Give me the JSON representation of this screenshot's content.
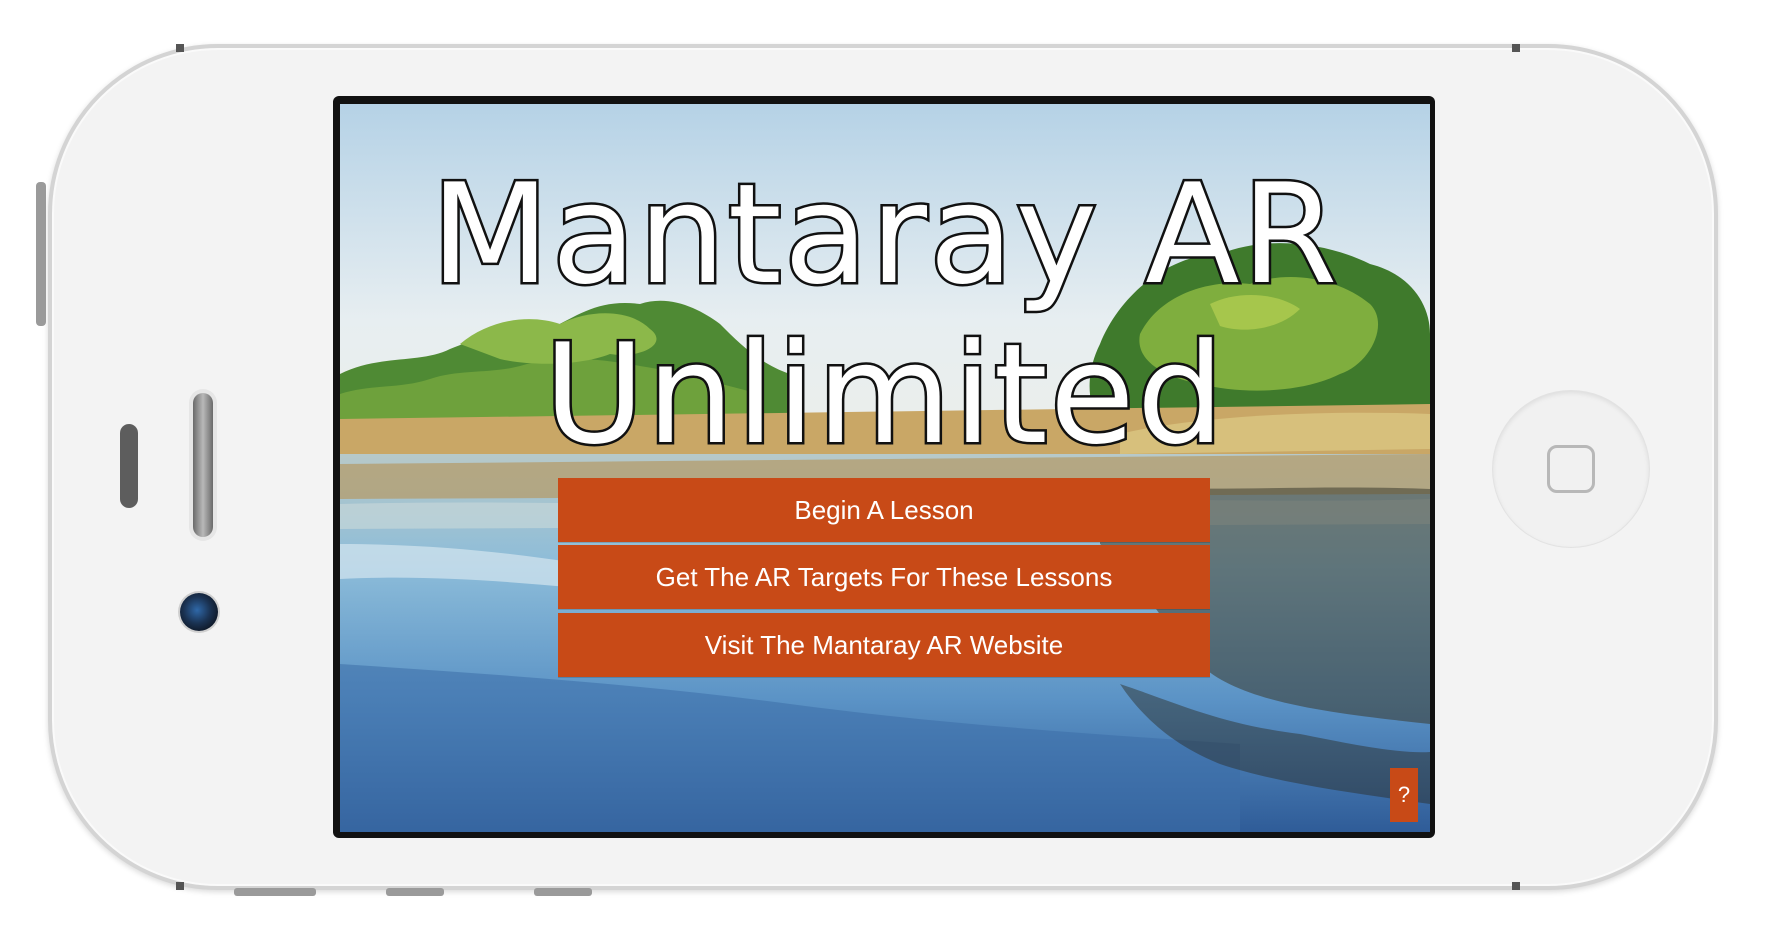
{
  "app": {
    "title_line1": "Mantaray AR",
    "title_line2": "Unlimited"
  },
  "menu": {
    "begin_lesson": "Begin A Lesson",
    "get_targets": "Get The AR Targets For These Lessons",
    "visit_website": "Visit The Mantaray AR Website",
    "help": "?"
  },
  "colors": {
    "button_bg": "#c84a17",
    "button_text": "#ffffff"
  },
  "icons": {
    "home": "home-button-icon",
    "camera": "front-camera-icon",
    "speaker": "earpiece-speaker-icon"
  }
}
